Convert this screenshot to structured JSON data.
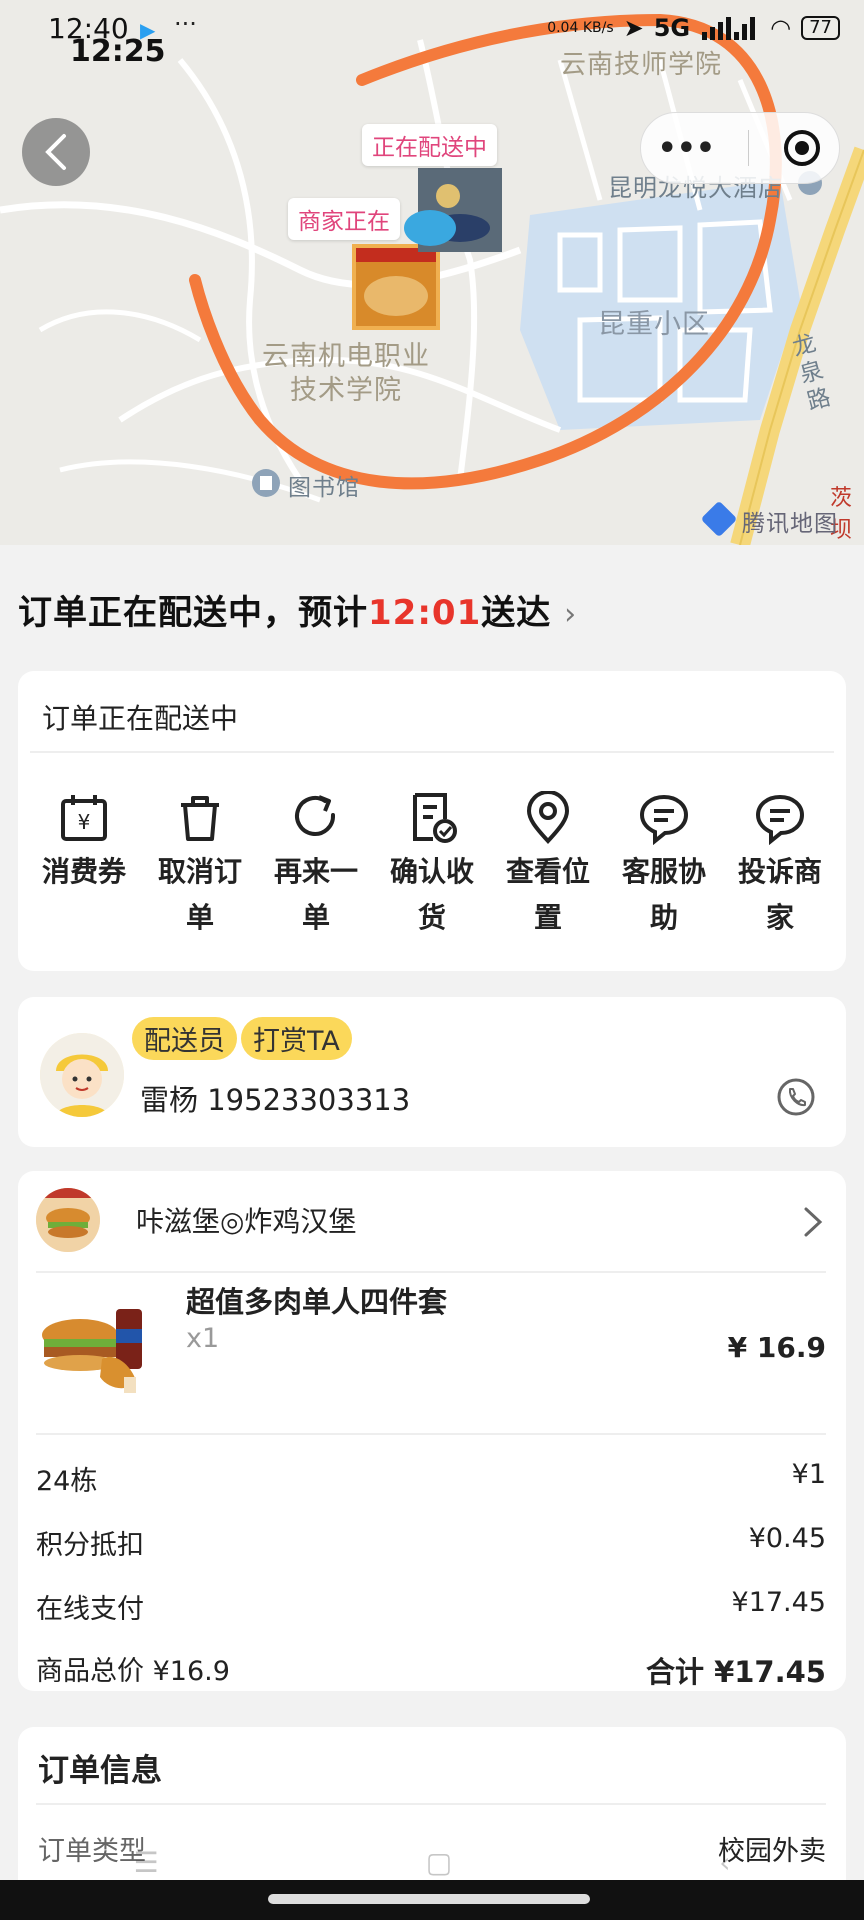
{
  "status_bar": {
    "time": "12:40",
    "time_overlay": "12:25",
    "speed": "0.04 KB/s",
    "network": "5G",
    "battery": "77"
  },
  "map": {
    "bubble_delivering": "正在配送中",
    "bubble_merchant": "商家正在",
    "label_school_top": "云南技师学院",
    "label_hotel": "昆明龙悦大酒店",
    "label_community": "昆重小区",
    "label_road": "龙泉路",
    "label_campus_line1": "云南机电职业",
    "label_campus_line2": "技术学院",
    "label_library": "图书馆",
    "label_corner": "茨坝",
    "map_provider": "腾讯地图"
  },
  "order_status": {
    "headline_prefix": "订单正在配送中，预计",
    "eta": "12:01",
    "headline_suffix": "送达",
    "chevron": "›"
  },
  "status_card": {
    "title": "订单正在配送中",
    "actions": [
      {
        "label": "消费券",
        "icon": "coupon-icon"
      },
      {
        "label": "取消订单",
        "icon": "trash-icon"
      },
      {
        "label": "再来一单",
        "icon": "refresh-icon"
      },
      {
        "label": "确认收货",
        "icon": "receipt-check-icon"
      },
      {
        "label": "查看位置",
        "icon": "location-pin-icon"
      },
      {
        "label": "客服协助",
        "icon": "chat-bubble-icon"
      },
      {
        "label": "投诉商家",
        "icon": "chat-bubble-icon"
      }
    ]
  },
  "rider": {
    "badge_role": "配送员",
    "badge_tip": "打赏TA",
    "name_phone": "雷杨 19523303313"
  },
  "order": {
    "shop_name": "咔滋堡◎炸鸡汉堡",
    "item_title": "超值多肉单人四件套",
    "item_qty": "x1",
    "item_price": "¥ 16.9",
    "fees": [
      {
        "label": "24栋",
        "value": "¥1"
      },
      {
        "label": "积分抵扣",
        "value": "¥0.45"
      },
      {
        "label": "在线支付",
        "value": "¥17.45"
      }
    ],
    "goods_total": "商品总价 ¥16.9",
    "grand_total": "合计 ¥17.45"
  },
  "order_info": {
    "title": "订单信息",
    "type_label": "订单类型",
    "type_value": "校园外卖"
  },
  "colors": {
    "accent_red": "#e8352b",
    "badge_yellow": "#fbd85a",
    "annotation_orange": "#f47a3c"
  }
}
